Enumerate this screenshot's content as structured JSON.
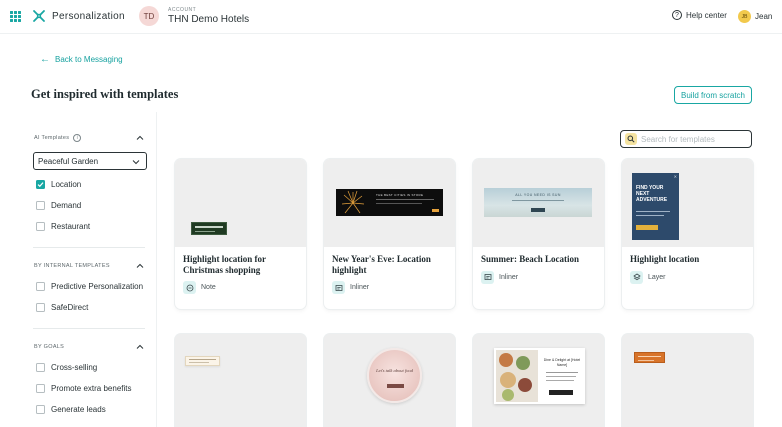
{
  "topbar": {
    "app_name": "Personalization",
    "account_initials": "TD",
    "account_label": "ACCOUNT",
    "account_name": "THN Demo Hotels",
    "help_label": "Help center",
    "user_initials": "JB",
    "user_name": "Jean"
  },
  "page": {
    "back_label": "Back to Messaging",
    "title": "Get inspired with templates",
    "build_button": "Build from scratch"
  },
  "sidebar": {
    "ai_section": {
      "label": "AI Templates",
      "select_value": "Peaceful Garden",
      "options": [
        {
          "label": "Location",
          "checked": true
        },
        {
          "label": "Demand",
          "checked": false
        },
        {
          "label": "Restaurant",
          "checked": false
        }
      ]
    },
    "internal_section": {
      "label": "BY INTERNAL TEMPLATES",
      "options": [
        {
          "label": "Predictive Personalization",
          "checked": false
        },
        {
          "label": "SafeDirect",
          "checked": false
        }
      ]
    },
    "goals_section": {
      "label": "BY GOALS",
      "options": [
        {
          "label": "Cross-selling",
          "checked": false
        },
        {
          "label": "Promote extra benefits",
          "checked": false
        },
        {
          "label": "Generate leads",
          "checked": false
        }
      ]
    }
  },
  "search": {
    "placeholder": "Search for templates"
  },
  "cards": [
    {
      "title": "Highlight location for Christmas shopping",
      "type": "Note"
    },
    {
      "title": "New Year's Eve: Location highlight",
      "type": "Inliner"
    },
    {
      "title": "Summer: Beach Location",
      "type": "Inliner"
    },
    {
      "title": "Highlight location",
      "type": "Layer"
    }
  ],
  "preview_text": {
    "newyear_banner": "THE BEST CITIES IN STORE",
    "summer_banner": "ALL YOU NEED IS SUN",
    "layer_heading": "FIND YOUR NEXT ADVENTURE",
    "food_circle": "Let's talk about food",
    "dining_heading": "Dine & Delight at [Hotel Name]"
  },
  "colors": {
    "accent": "#19a7a3",
    "text": "#1f2a2e",
    "preview_bg": "#eeeeee",
    "layer_navy": "#2d4a6b",
    "orange_badge": "#d8742a"
  }
}
